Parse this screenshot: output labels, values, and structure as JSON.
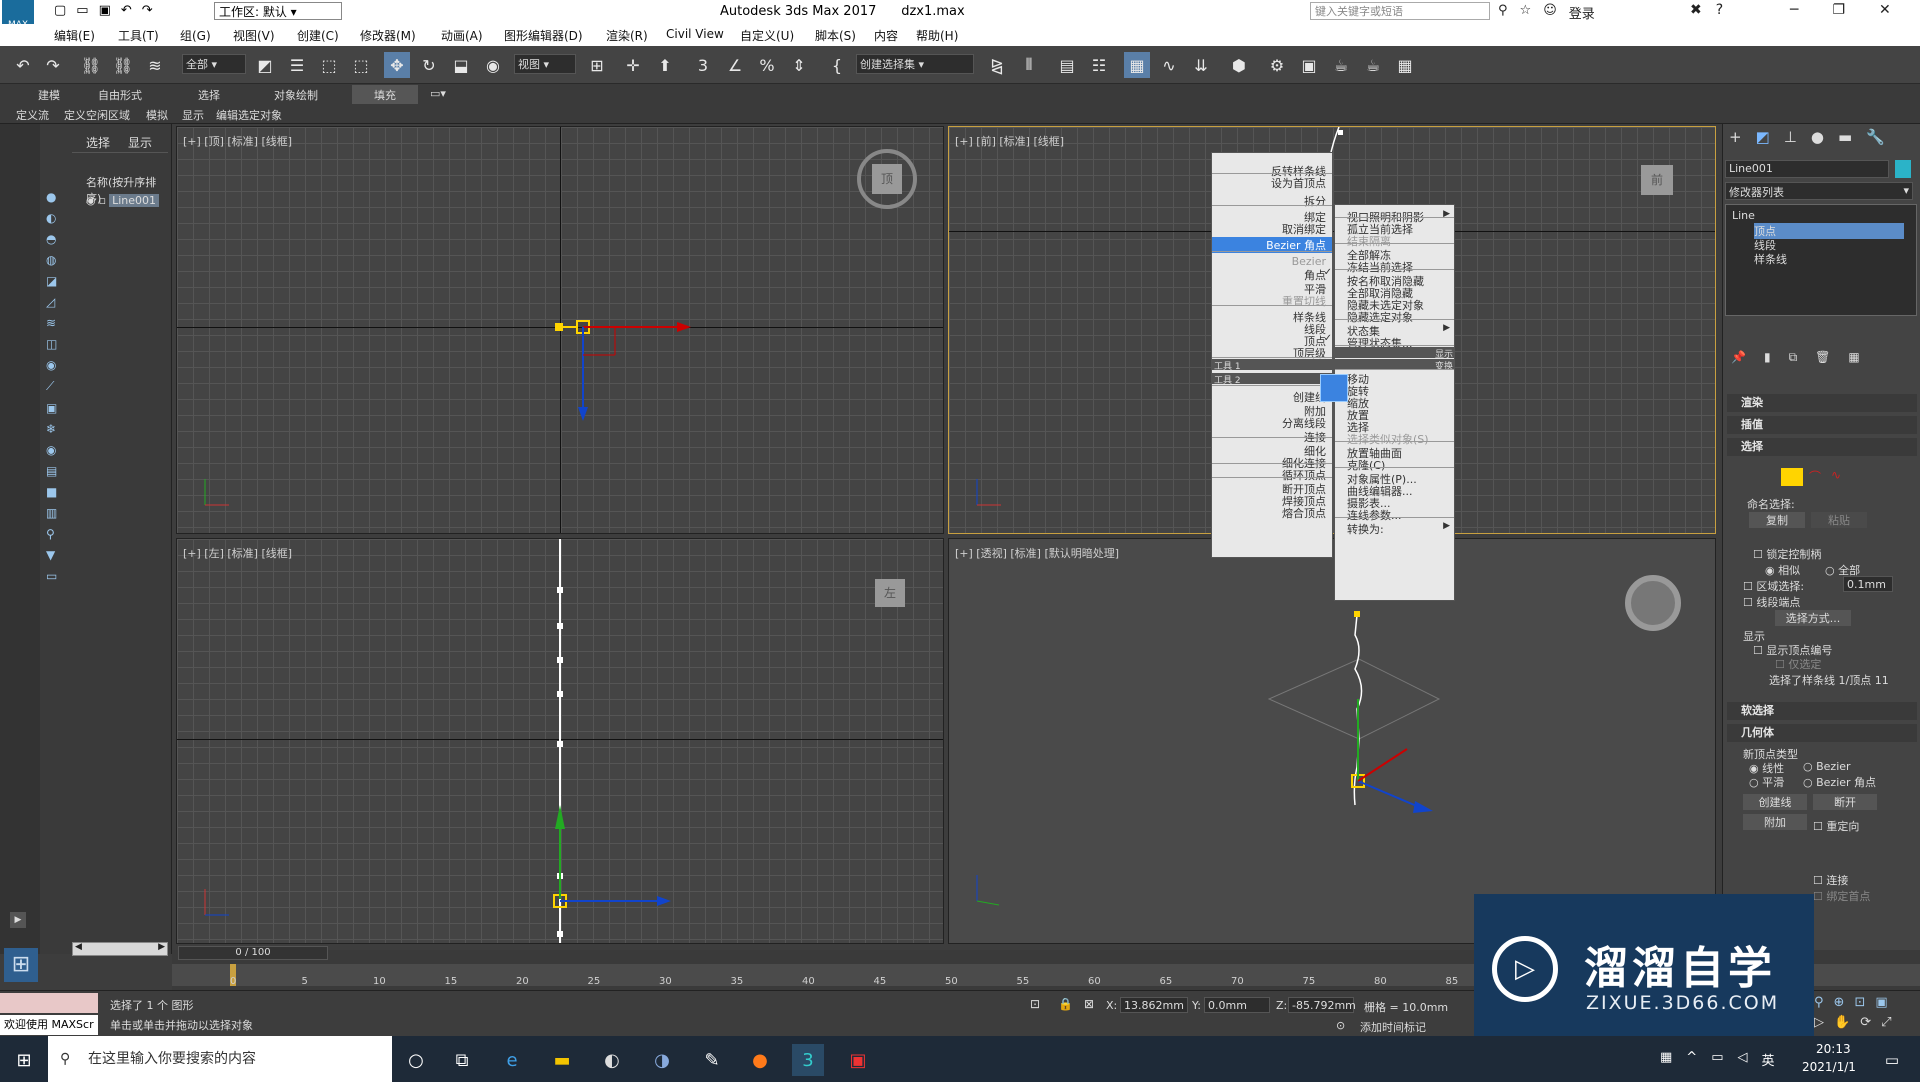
{
  "titlebar": {
    "app_title": "Autodesk 3ds Max 2017",
    "file": "dzx1.max",
    "workspace": "工作区: 默认",
    "search_placeholder": "键入关键字或短语",
    "login": "登录",
    "logo": "MAX"
  },
  "menu": [
    "编辑(E)",
    "工具(T)",
    "组(G)",
    "视图(V)",
    "创建(C)",
    "修改器(M)",
    "动画(A)",
    "图形编辑器(D)",
    "渲染(R)",
    "Civil View",
    "自定义(U)",
    "脚本(S)",
    "内容",
    "帮助(H)"
  ],
  "toolbar": {
    "filter": "全部",
    "ref_coord": "视图",
    "selset": "创建选择集"
  },
  "ribbon_tabs": [
    "建模",
    "自由形式",
    "选择",
    "对象绘制",
    "填充"
  ],
  "ribbon_sub": [
    "定义流",
    "定义空闲区域",
    "模拟",
    "显示",
    "编辑选定对象"
  ],
  "scene": {
    "tabs": [
      "选择",
      "显示"
    ],
    "header": "名称(按升序排序)",
    "item": "Line001",
    "scroll": "0 / 100"
  },
  "viewports": {
    "top": "[+] [顶] [标准] [线框]",
    "front": "[+] [前] [标准] [线框]",
    "left": "[+] [左] [标准] [线框]",
    "persp": "[+] [透视] [标准] [默认明暗处理]",
    "cube_top": "顶",
    "cube_front": "前",
    "cube_left": "左"
  },
  "context_left": [
    {
      "label": "反转样条线",
      "disabled": false
    },
    {
      "label": "设为首顶点",
      "disabled": false
    },
    {
      "label": "拆分",
      "disabled": false
    },
    {
      "label": "绑定",
      "disabled": false
    },
    {
      "label": "取消绑定",
      "disabled": false
    },
    {
      "label": "Bezier 角点",
      "highlight": true
    },
    {
      "label": "Bezier",
      "disabled": true
    },
    {
      "label": "角点",
      "check": true
    },
    {
      "label": "平滑",
      "disabled": false
    },
    {
      "label": "重置切线",
      "disabled": true
    },
    {
      "label": "样条线",
      "disabled": false
    },
    {
      "label": "线段",
      "disabled": false
    },
    {
      "label": "顶点",
      "check": true
    },
    {
      "label": "顶层级",
      "disabled": false
    },
    {
      "label": "工具 1",
      "bar": true
    },
    {
      "label": "工具 2",
      "bar": true
    },
    {
      "label": "创建线",
      "disabled": false
    },
    {
      "label": "附加",
      "disabled": false
    },
    {
      "label": "分离线段",
      "disabled": false
    },
    {
      "label": "连接",
      "disabled": false
    },
    {
      "label": "细化",
      "disabled": false
    },
    {
      "label": "细化连接",
      "disabled": false
    },
    {
      "label": "循环顶点",
      "disabled": false
    },
    {
      "label": "断开顶点",
      "disabled": false
    },
    {
      "label": "焊接顶点",
      "disabled": false
    },
    {
      "label": "熔合顶点",
      "disabled": false
    }
  ],
  "context_right": [
    {
      "label": "视口照明和阴影",
      "arrow": true
    },
    {
      "label": "孤立当前选择"
    },
    {
      "label": "结束隔离",
      "disabled": true
    },
    {
      "label": "全部解冻"
    },
    {
      "label": "冻结当前选择"
    },
    {
      "label": "按名称取消隐藏"
    },
    {
      "label": "全部取消隐藏"
    },
    {
      "label": "隐藏未选定对象"
    },
    {
      "label": "隐藏选定对象"
    },
    {
      "label": "状态集",
      "arrow": true
    },
    {
      "label": "管理状态集..."
    },
    {
      "label": "显示",
      "bar": true
    },
    {
      "label": "变换",
      "bar": true
    },
    {
      "label": "移动"
    },
    {
      "label": "旋转"
    },
    {
      "label": "缩放"
    },
    {
      "label": "放置"
    },
    {
      "label": "选择"
    },
    {
      "label": "选择类似对象(S)",
      "disabled": true
    },
    {
      "label": "放置轴曲面"
    },
    {
      "label": "克隆(C)"
    },
    {
      "label": "对象属性(P)..."
    },
    {
      "label": "曲线编辑器..."
    },
    {
      "label": "摄影表..."
    },
    {
      "label": "连线参数..."
    },
    {
      "label": "转换为:",
      "arrow": true
    }
  ],
  "right_panel": {
    "object_name": "Line001",
    "modifier_list": "修改器列表",
    "stack": [
      "Line",
      "顶点",
      "线段",
      "样条线"
    ],
    "rollouts": [
      "渲染",
      "插值",
      "选择",
      "软选择",
      "几何体"
    ],
    "named_sel": "命名选择:",
    "copy": "复制",
    "paste": "粘贴",
    "lock_handles": "锁定控制柄",
    "similar": "相似",
    "all": "全部",
    "area_sel": "区域选择:",
    "area_val": "0.1mm",
    "seg_end": "线段端点",
    "select_by": "选择方式...",
    "display": "显示",
    "show_vertex_num": "显示顶点编号",
    "only_selected": "仅选定",
    "sel_status": "选择了样条线 1/顶点 11",
    "new_vertex_type": "新顶点类型",
    "linear": "线性",
    "bezier": "Bezier",
    "smooth": "平滑",
    "bezier_corner": "Bezier 角点",
    "create_line": "创建线",
    "break": "断开",
    "attach": "附加",
    "reorient": "重定向",
    "connect": "连接",
    "bind_first": "绑定首点"
  },
  "timeline": {
    "ticks": [
      "0",
      "5",
      "10",
      "15",
      "20",
      "25",
      "30",
      "35",
      "40",
      "45",
      "50",
      "55",
      "60",
      "65",
      "70",
      "75",
      "80",
      "85"
    ]
  },
  "status": {
    "welcome": "欢迎使用 MAXScr",
    "sel_info": "选择了 1 个 图形",
    "hint": "单击或单击并拖动以选择对象",
    "x_label": "X:",
    "x": "13.862mm",
    "y_label": "Y:",
    "y": "0.0mm",
    "z_label": "Z:",
    "z": "-85.792mm",
    "grid": "栅格 = 10.0mm",
    "add_time_tag": "添加时间标记"
  },
  "taskbar": {
    "search": "在这里输入你要搜索的内容",
    "time": "20:13",
    "date": "2021/1/1"
  },
  "watermark": {
    "cn": "溜溜自学",
    "url": "ZIXUE.3D66.COM"
  }
}
